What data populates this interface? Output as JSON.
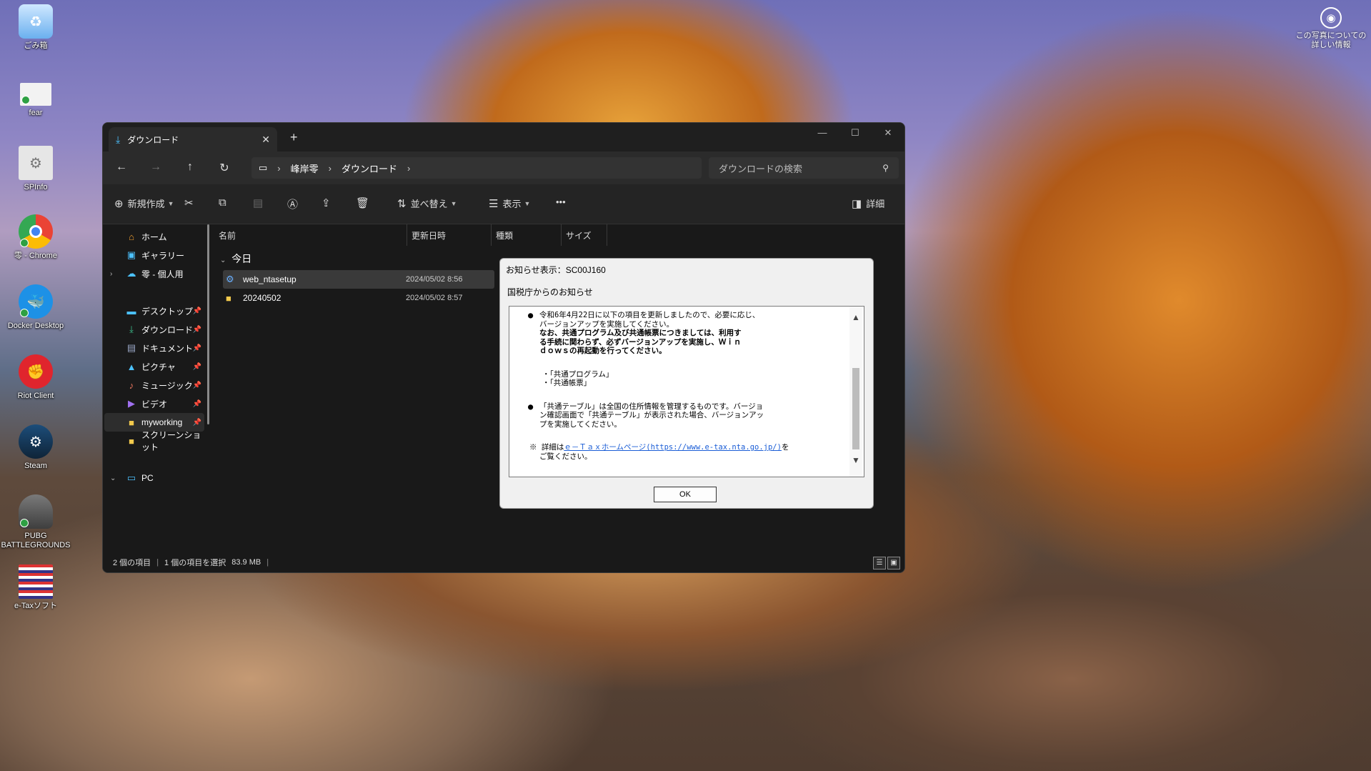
{
  "desktop": {
    "icons": [
      {
        "label": "ごみ箱",
        "icon": "recycle-bin-icon",
        "color": "#3a8fd8"
      },
      {
        "label": "fear",
        "icon": "text-file-icon",
        "color": "#e8e8e8"
      },
      {
        "label": "SPInfo",
        "icon": "settings-file-icon",
        "color": "#d8d8d8"
      },
      {
        "label": "零 - Chrome",
        "icon": "chrome-icon",
        "color": "#e8453c"
      },
      {
        "label": "Docker Desktop",
        "icon": "docker-icon",
        "color": "#1d91e6"
      },
      {
        "label": "Riot Client",
        "icon": "riot-icon",
        "color": "#e0252d"
      },
      {
        "label": "Steam",
        "icon": "steam-icon",
        "color": "#1b3a5c"
      },
      {
        "label": "PUBG BATTLEGROUNDS",
        "icon": "pubg-icon",
        "color": "#555555"
      },
      {
        "label": "e-Taxソフト",
        "icon": "etax-icon",
        "color": "#d9d9f0"
      }
    ],
    "photo_info": "この写真についての詳しい情報"
  },
  "explorer": {
    "tab_title": "ダウンロード",
    "breadcrumb": [
      "峰岸零",
      "ダウンロード"
    ],
    "search_placeholder": "ダウンロードの検索",
    "toolbar": {
      "new": "新規作成",
      "sort": "並べ替え",
      "view": "表示",
      "more": "•••",
      "details": "詳細"
    },
    "sidebar": {
      "home": "ホーム",
      "gallery": "ギャラリー",
      "onedrive": "零 - 個人用",
      "desktop": "デスクトップ",
      "downloads": "ダウンロード",
      "documents": "ドキュメント",
      "pictures": "ピクチャ",
      "music": "ミュージック",
      "videos": "ビデオ",
      "myworking": "myworking",
      "screenshots": "スクリーンショット",
      "pc": "PC"
    },
    "columns": {
      "name": "名前",
      "date": "更新日時",
      "type": "種類",
      "size": "サイズ"
    },
    "group_label": "今日",
    "files": [
      {
        "name": "web_ntasetup",
        "date": "2024/05/02 8:56"
      },
      {
        "name": "20240502",
        "date": "2024/05/02 8:57"
      }
    ],
    "status": {
      "count": "2 個の項目",
      "selected": "1 個の項目を選択",
      "size": "83.9 MB"
    }
  },
  "dialog": {
    "title": "お知らせ表示：SC00J160",
    "heading": "国税庁からのお知らせ",
    "p1_line1": "令和6年4月22日に以下の項目を更新しましたので、必要に応じ、",
    "p1_line2": "バージョンアップを実施してください。",
    "p1_bold1": "なお、共通プログラム及び共通帳票につきましては、利用す",
    "p1_bold2": "る手続に関わらず、必ずバージョンアップを実施し、Ｗｉｎ",
    "p1_bold3": "ｄｏｗｓの再起動を行ってください。",
    "item1": "・「共通プログラム」",
    "item2": "・「共通帳票」",
    "p2_line1": "「共通テーブル」は全国の住所情報を管理するものです。バージョ",
    "p2_line2": "ン確認画面で「共通テーブル」が表示された場合、バージョンアッ",
    "p2_line3": "プを実施してください。",
    "note_prefix": "※ 詳細は",
    "note_link": "ｅ－Ｔａｘホームページ(https://www.e-tax.nta.go.jp/)",
    "note_suffix": "を",
    "note_line2": "ご覧ください。",
    "ok": "OK"
  }
}
